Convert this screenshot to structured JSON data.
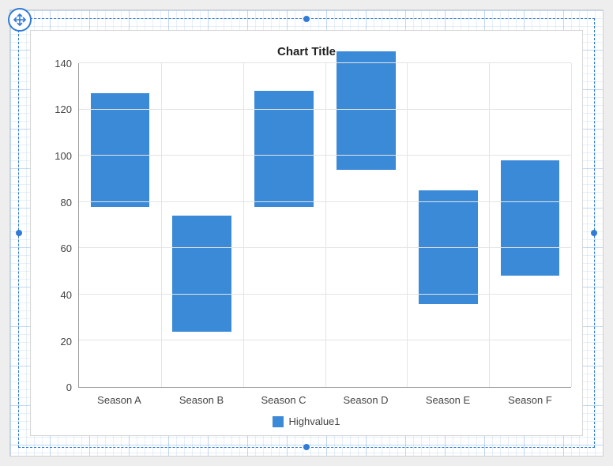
{
  "chart_data": {
    "type": "bar",
    "title": "Chart Title",
    "xlabel": "",
    "ylabel": "",
    "ylim": [
      0,
      140
    ],
    "y_ticks": [
      0,
      20,
      40,
      60,
      80,
      100,
      120,
      140
    ],
    "categories": [
      "Season A",
      "Season B",
      "Season C",
      "Season D",
      "Season E",
      "Season F"
    ],
    "series": [
      {
        "name": "Highvalue1",
        "low": [
          78,
          24,
          78,
          94,
          36,
          48
        ],
        "high": [
          127,
          74,
          128,
          145,
          85,
          98
        ]
      }
    ],
    "legend": [
      "Highvalue1"
    ],
    "colors": {
      "series1": "#3b8ad8"
    }
  }
}
